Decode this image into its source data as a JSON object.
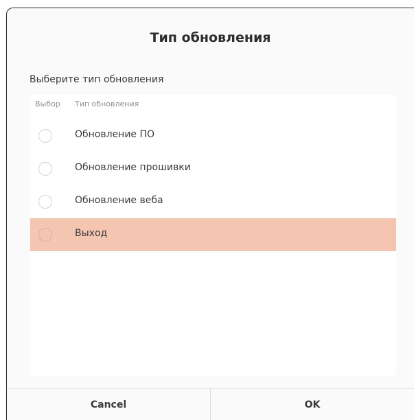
{
  "dialog": {
    "title": "Тип обновления",
    "prompt": "Выберите тип обновления"
  },
  "list": {
    "columns": {
      "select": "Выбор",
      "type": "Тип обновления"
    },
    "rows": [
      {
        "label": "Обновление ПО",
        "selected": false
      },
      {
        "label": "Обновление прошивки",
        "selected": false
      },
      {
        "label": "Обновление веба",
        "selected": false
      },
      {
        "label": "Выход",
        "selected": true
      }
    ]
  },
  "buttons": {
    "cancel": "Cancel",
    "ok": "OK"
  },
  "colors": {
    "selected_row": "#f4c6b2",
    "accent": "#e95420"
  }
}
